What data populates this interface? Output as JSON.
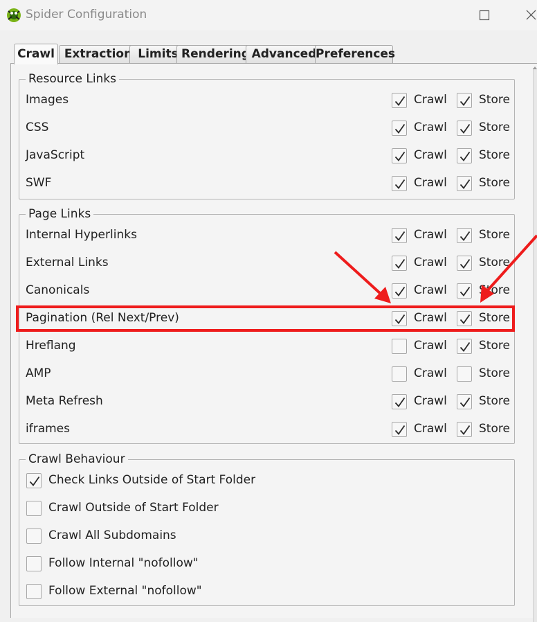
{
  "window": {
    "title": "Spider Configuration",
    "icon": "spider-frog-icon",
    "controls": [
      "maximize-icon",
      "close-icon"
    ]
  },
  "tabs": [
    {
      "label": "Crawl",
      "active": true
    },
    {
      "label": "Extraction",
      "active": false
    },
    {
      "label": "Limits",
      "active": false
    },
    {
      "label": "Rendering",
      "active": false
    },
    {
      "label": "Advanced",
      "active": false
    },
    {
      "label": "Preferences",
      "active": false
    }
  ],
  "resource_links": {
    "title": "Resource Links",
    "crawl_label": "Crawl",
    "store_label": "Store",
    "rows": [
      {
        "label": "Images",
        "crawl": true,
        "store": true
      },
      {
        "label": "CSS",
        "crawl": true,
        "store": true
      },
      {
        "label": "JavaScript",
        "crawl": true,
        "store": true
      },
      {
        "label": "SWF",
        "crawl": true,
        "store": true
      }
    ]
  },
  "page_links": {
    "title": "Page Links",
    "crawl_label": "Crawl",
    "store_label": "Store",
    "rows": [
      {
        "label": "Internal Hyperlinks",
        "crawl": true,
        "store": true
      },
      {
        "label": "External Links",
        "crawl": true,
        "store": true
      },
      {
        "label": "Canonicals",
        "crawl": true,
        "store": true
      },
      {
        "label": "Pagination (Rel Next/Prev)",
        "crawl": true,
        "store": true,
        "highlighted": true
      },
      {
        "label": "Hreflang",
        "crawl": false,
        "store": true
      },
      {
        "label": "AMP",
        "crawl": false,
        "store": false
      },
      {
        "label": "Meta Refresh",
        "crawl": true,
        "store": true
      },
      {
        "label": "iframes",
        "crawl": true,
        "store": true
      }
    ]
  },
  "crawl_behaviour": {
    "title": "Crawl Behaviour",
    "options": [
      {
        "label": "Check Links Outside of Start Folder",
        "checked": true
      },
      {
        "label": "Crawl Outside of Start Folder",
        "checked": false
      },
      {
        "label": "Crawl All Subdomains",
        "checked": false
      },
      {
        "label": "Follow Internal \"nofollow\"",
        "checked": false
      },
      {
        "label": "Follow External \"nofollow\"",
        "checked": false
      }
    ]
  },
  "annotation": {
    "highlight_color": "#ee1c1c",
    "arrows": [
      "red-arrow-to-crawl",
      "red-arrow-to-store"
    ]
  },
  "colors": {
    "window_bg": "#f0f0f0",
    "panel_bg": "#f4f4f4",
    "title_text": "#8a8a8a",
    "border": "#b4b4b4"
  }
}
